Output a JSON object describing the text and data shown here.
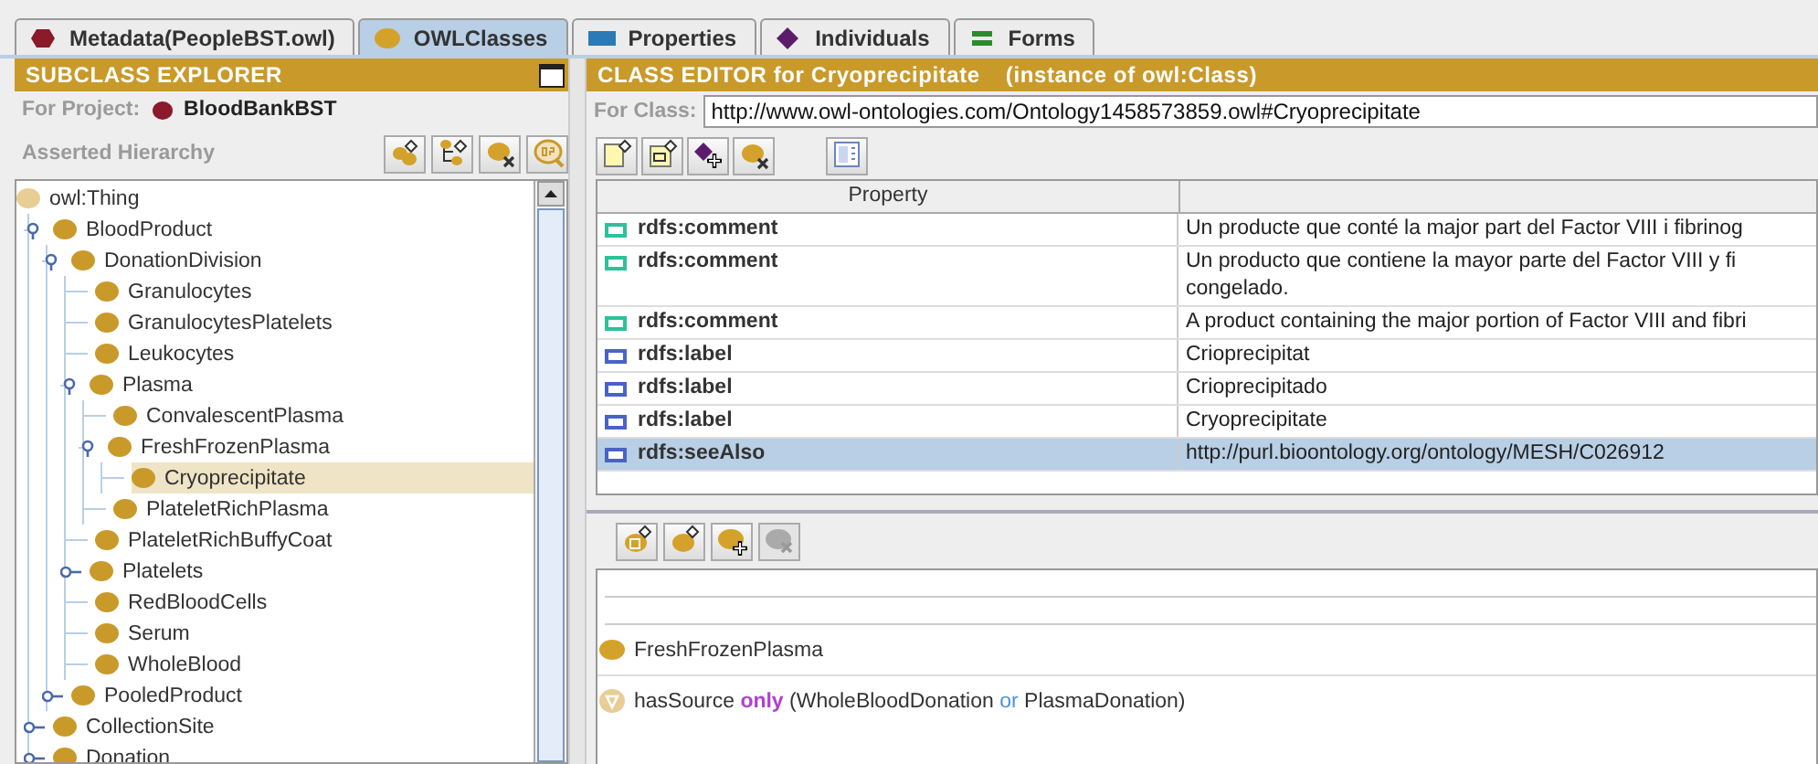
{
  "tabs": [
    {
      "label": "Metadata(PeopleBST.owl)",
      "kind": "metadata",
      "selected": false
    },
    {
      "label": "OWLClasses",
      "kind": "classes",
      "selected": true
    },
    {
      "label": "Properties",
      "kind": "properties",
      "selected": false
    },
    {
      "label": "Individuals",
      "kind": "individuals",
      "selected": false
    },
    {
      "label": "Forms",
      "kind": "forms",
      "selected": false
    }
  ],
  "subclass_explorer": {
    "title": "SUBCLASS EXPLORER",
    "project_label": "For Project:",
    "project": "BloodBankBST",
    "hierarchy_label": "Asserted Hierarchy",
    "toolbar": [
      {
        "kind": "add-subclass"
      },
      {
        "kind": "add-sibling"
      },
      {
        "kind": "delete"
      },
      {
        "kind": "breakpoint"
      }
    ],
    "tree": {
      "label": "owl:Thing",
      "selected": false,
      "children": [
        {
          "label": "BloodProduct",
          "expanded": true,
          "selected": false,
          "children": [
            {
              "label": "DonationDivision",
              "expanded": true,
              "selected": false,
              "children": [
                {
                  "label": "Granulocytes",
                  "selected": false
                },
                {
                  "label": "GranulocytesPlatelets",
                  "selected": false
                },
                {
                  "label": "Leukocytes",
                  "selected": false
                },
                {
                  "label": "Plasma",
                  "expanded": true,
                  "selected": false,
                  "children": [
                    {
                      "label": "ConvalescentPlasma",
                      "selected": false
                    },
                    {
                      "label": "FreshFrozenPlasma",
                      "expanded": true,
                      "selected": false,
                      "children": [
                        {
                          "label": "Cryoprecipitate",
                          "selected": true
                        }
                      ]
                    },
                    {
                      "label": "PlateletRichPlasma",
                      "selected": false
                    }
                  ]
                },
                {
                  "label": "PlateletRichBuffyCoat",
                  "selected": false
                },
                {
                  "label": "Platelets",
                  "expanded": false,
                  "selected": false
                },
                {
                  "label": "RedBloodCells",
                  "selected": false
                },
                {
                  "label": "Serum",
                  "selected": false
                },
                {
                  "label": "WholeBlood",
                  "selected": false
                }
              ]
            },
            {
              "label": "PooledProduct",
              "expanded": false,
              "selected": false
            }
          ]
        },
        {
          "label": "CollectionSite",
          "expanded": false,
          "selected": false
        },
        {
          "label": "Donation",
          "expanded": false,
          "selected": false
        }
      ]
    }
  },
  "class_editor": {
    "title": "CLASS EDITOR for Cryoprecipitate",
    "subtitle": "(instance of owl:Class)",
    "class_label": "For Class:",
    "class_uri": "http://www.owl-ontologies.com/Ontology1458573859.owl#Cryoprecipitate",
    "toolbar": [
      {
        "kind": "add-annotation"
      },
      {
        "kind": "add-datatype"
      },
      {
        "kind": "add-instance"
      },
      {
        "kind": "delete"
      },
      {
        "kind": "layout"
      }
    ],
    "table": {
      "columns": [
        "Property"
      ],
      "rows": [
        {
          "kind": "comment",
          "property": "rdfs:comment",
          "value": [
            "Un producte que conté la major part del Factor VIII i fibrinog"
          ],
          "selected": false
        },
        {
          "kind": "comment",
          "property": "rdfs:comment",
          "value": [
            "Un producto que contiene la mayor parte del Factor VIII y fi",
            "congelado."
          ],
          "selected": false
        },
        {
          "kind": "comment",
          "property": "rdfs:comment",
          "value": [
            "A product containing the major portion of Factor VIII and fibri"
          ],
          "selected": false
        },
        {
          "kind": "label",
          "property": "rdfs:label",
          "value": [
            "Crioprecipitat"
          ],
          "selected": false
        },
        {
          "kind": "label",
          "property": "rdfs:label",
          "value": [
            "Crioprecipitado"
          ],
          "selected": false
        },
        {
          "kind": "label",
          "property": "rdfs:label",
          "value": [
            "Cryoprecipitate"
          ],
          "selected": false
        },
        {
          "kind": "label",
          "property": "rdfs:seeAlso",
          "value": [
            "http://purl.bioontology.org/ontology/MESH/C026912"
          ],
          "selected": true
        }
      ]
    },
    "conditions_toolbar": [
      {
        "kind": "add-named",
        "disabled": false
      },
      {
        "kind": "add-restriction",
        "disabled": false
      },
      {
        "kind": "add-class",
        "disabled": false
      },
      {
        "kind": "remove",
        "disabled": true
      }
    ],
    "conditions": [
      {
        "kind": "class",
        "tokens": [
          {
            "kind": "name",
            "text": "FreshFrozenPlasma"
          }
        ]
      },
      {
        "kind": "restriction",
        "tokens": [
          {
            "kind": "name",
            "text": "hasSource"
          },
          {
            "kind": "quantifier",
            "text": "only"
          },
          {
            "kind": "name",
            "text": "(WholeBloodDonation"
          },
          {
            "kind": "operator",
            "text": "or"
          },
          {
            "kind": "name",
            "text": "PlasmaDonation)"
          }
        ]
      }
    ]
  }
}
